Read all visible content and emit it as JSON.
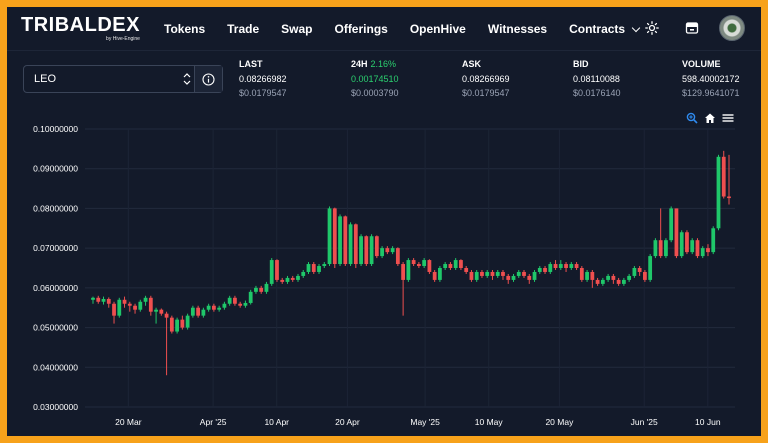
{
  "nav": {
    "brand": "TRIBALDEX",
    "brand_sub": "by Hive-Engine",
    "items": [
      "Tokens",
      "Trade",
      "Swap",
      "Offerings",
      "OpenHive",
      "Witnesses"
    ],
    "contracts": "Contracts",
    "icons": [
      "sun-icon",
      "wallet-icon",
      "avatar"
    ]
  },
  "pair": {
    "value": "LEO"
  },
  "stats": [
    {
      "label": "LAST",
      "value": "0.08266982",
      "usd": "$0.0179547"
    },
    {
      "label": "24H",
      "change": "2.16%",
      "value": "0.00174510",
      "usd": "$0.0003790"
    },
    {
      "label": "ASK",
      "value": "0.08266969",
      "usd": "$0.0179547"
    },
    {
      "label": "BID",
      "value": "0.08110088",
      "usd": "$0.0176140"
    },
    {
      "label": "VOLUME",
      "value": "598.40002172",
      "usd": "$129.9641071"
    }
  ],
  "colors": {
    "up": "#1fc76a",
    "down": "#ef4f4f",
    "accent": "#2bd06f",
    "bg": "#131a2a",
    "border": "#f7a21b"
  },
  "chart_data": {
    "type": "candlestick",
    "ylim": [
      0.03,
      0.1
    ],
    "yticks": [
      "0.03000000",
      "0.04000000",
      "0.05000000",
      "0.06000000",
      "0.07000000",
      "0.08000000",
      "0.09000000",
      "0.10000000"
    ],
    "xticks": [
      "20 Mar",
      "Apr '25",
      "10 Apr",
      "20 Apr",
      "May '25",
      "10 May",
      "20 May",
      "Jun '25",
      "10 Jun"
    ],
    "x_start": "2025-03-15",
    "candles": [
      [
        0.057,
        0.0575,
        0.056,
        0.0578
      ],
      [
        0.0575,
        0.0565,
        0.056,
        0.058
      ],
      [
        0.0565,
        0.0572,
        0.0558,
        0.0578
      ],
      [
        0.0572,
        0.056,
        0.055,
        0.0576
      ],
      [
        0.056,
        0.053,
        0.051,
        0.0565
      ],
      [
        0.053,
        0.057,
        0.0525,
        0.0575
      ],
      [
        0.057,
        0.056,
        0.055,
        0.0578
      ],
      [
        0.056,
        0.0555,
        0.054,
        0.0565
      ],
      [
        0.0555,
        0.0545,
        0.0535,
        0.056
      ],
      [
        0.0545,
        0.0565,
        0.054,
        0.057
      ],
      [
        0.0565,
        0.0575,
        0.0555,
        0.058
      ],
      [
        0.0575,
        0.054,
        0.053,
        0.058
      ],
      [
        0.054,
        0.0545,
        0.051,
        0.055
      ],
      [
        0.0545,
        0.0535,
        0.053,
        0.0548
      ],
      [
        0.0535,
        0.0525,
        0.038,
        0.054
      ],
      [
        0.0525,
        0.049,
        0.0485,
        0.053
      ],
      [
        0.049,
        0.052,
        0.0485,
        0.0525
      ],
      [
        0.052,
        0.05,
        0.0495,
        0.053
      ],
      [
        0.05,
        0.053,
        0.0495,
        0.0535
      ],
      [
        0.053,
        0.055,
        0.0525,
        0.0555
      ],
      [
        0.055,
        0.053,
        0.0525,
        0.0555
      ],
      [
        0.053,
        0.0545,
        0.0525,
        0.055
      ],
      [
        0.0545,
        0.0555,
        0.054,
        0.056
      ],
      [
        0.0555,
        0.0545,
        0.054,
        0.056
      ],
      [
        0.0545,
        0.055,
        0.054,
        0.0555
      ],
      [
        0.055,
        0.056,
        0.0545,
        0.0565
      ],
      [
        0.056,
        0.0575,
        0.0555,
        0.058
      ],
      [
        0.0575,
        0.056,
        0.0555,
        0.058
      ],
      [
        0.056,
        0.0555,
        0.055,
        0.0565
      ],
      [
        0.0555,
        0.0562,
        0.055,
        0.0568
      ],
      [
        0.0562,
        0.059,
        0.0558,
        0.0595
      ],
      [
        0.059,
        0.06,
        0.0585,
        0.0605
      ],
      [
        0.06,
        0.059,
        0.0585,
        0.0605
      ],
      [
        0.059,
        0.061,
        0.0585,
        0.0615
      ],
      [
        0.061,
        0.067,
        0.0605,
        0.0675
      ],
      [
        0.067,
        0.062,
        0.0615,
        0.0672
      ],
      [
        0.062,
        0.0615,
        0.061,
        0.0625
      ],
      [
        0.0615,
        0.0625,
        0.061,
        0.063
      ],
      [
        0.0625,
        0.062,
        0.0615,
        0.063
      ],
      [
        0.062,
        0.063,
        0.0615,
        0.0635
      ],
      [
        0.063,
        0.064,
        0.0625,
        0.0645
      ],
      [
        0.064,
        0.066,
        0.0635,
        0.0665
      ],
      [
        0.066,
        0.064,
        0.0635,
        0.0665
      ],
      [
        0.064,
        0.0655,
        0.0635,
        0.066
      ],
      [
        0.0655,
        0.066,
        0.065,
        0.0665
      ],
      [
        0.066,
        0.08,
        0.0655,
        0.0805
      ],
      [
        0.08,
        0.066,
        0.065,
        0.0802
      ],
      [
        0.066,
        0.078,
        0.0655,
        0.0785
      ],
      [
        0.078,
        0.066,
        0.0655,
        0.0782
      ],
      [
        0.066,
        0.076,
        0.0655,
        0.0765
      ],
      [
        0.076,
        0.066,
        0.065,
        0.0762
      ],
      [
        0.066,
        0.073,
        0.0655,
        0.0735
      ],
      [
        0.073,
        0.066,
        0.0655,
        0.0732
      ],
      [
        0.066,
        0.073,
        0.0655,
        0.0735
      ],
      [
        0.073,
        0.068,
        0.0675,
        0.0732
      ],
      [
        0.068,
        0.07,
        0.0675,
        0.0705
      ],
      [
        0.07,
        0.069,
        0.0685,
        0.0705
      ],
      [
        0.069,
        0.07,
        0.0685,
        0.0705
      ],
      [
        0.07,
        0.066,
        0.0655,
        0.0702
      ],
      [
        0.066,
        0.062,
        0.053,
        0.0665
      ],
      [
        0.062,
        0.067,
        0.0615,
        0.0675
      ],
      [
        0.067,
        0.066,
        0.0655,
        0.0675
      ],
      [
        0.066,
        0.0655,
        0.065,
        0.0665
      ],
      [
        0.0655,
        0.067,
        0.065,
        0.0675
      ],
      [
        0.067,
        0.064,
        0.0635,
        0.0672
      ],
      [
        0.064,
        0.062,
        0.0615,
        0.0645
      ],
      [
        0.062,
        0.065,
        0.0615,
        0.0655
      ],
      [
        0.065,
        0.066,
        0.0645,
        0.0665
      ],
      [
        0.066,
        0.065,
        0.0645,
        0.0665
      ],
      [
        0.065,
        0.067,
        0.0645,
        0.0675
      ],
      [
        0.067,
        0.065,
        0.0645,
        0.0672
      ],
      [
        0.065,
        0.064,
        0.0635,
        0.0655
      ],
      [
        0.064,
        0.062,
        0.0615,
        0.0645
      ],
      [
        0.062,
        0.064,
        0.0615,
        0.0645
      ],
      [
        0.064,
        0.063,
        0.0625,
        0.0645
      ],
      [
        0.063,
        0.064,
        0.0625,
        0.0645
      ],
      [
        0.064,
        0.063,
        0.062,
        0.0645
      ],
      [
        0.063,
        0.064,
        0.0625,
        0.0645
      ],
      [
        0.064,
        0.063,
        0.062,
        0.0645
      ],
      [
        0.063,
        0.062,
        0.061,
        0.0635
      ],
      [
        0.062,
        0.063,
        0.0615,
        0.0635
      ],
      [
        0.063,
        0.064,
        0.0625,
        0.0645
      ],
      [
        0.064,
        0.063,
        0.0625,
        0.0645
      ],
      [
        0.063,
        0.062,
        0.061,
        0.0635
      ],
      [
        0.062,
        0.064,
        0.0615,
        0.0645
      ],
      [
        0.064,
        0.065,
        0.0635,
        0.0655
      ],
      [
        0.065,
        0.064,
        0.0635,
        0.0655
      ],
      [
        0.064,
        0.066,
        0.0635,
        0.0665
      ],
      [
        0.066,
        0.065,
        0.0645,
        0.067
      ],
      [
        0.065,
        0.066,
        0.0645,
        0.067
      ],
      [
        0.066,
        0.065,
        0.064,
        0.0665
      ],
      [
        0.065,
        0.066,
        0.0645,
        0.0665
      ],
      [
        0.066,
        0.065,
        0.0645,
        0.0665
      ],
      [
        0.065,
        0.062,
        0.0615,
        0.0655
      ],
      [
        0.062,
        0.064,
        0.0615,
        0.0645
      ],
      [
        0.064,
        0.062,
        0.06,
        0.0645
      ],
      [
        0.062,
        0.061,
        0.0605,
        0.0625
      ],
      [
        0.061,
        0.062,
        0.0605,
        0.0625
      ],
      [
        0.062,
        0.063,
        0.0615,
        0.0635
      ],
      [
        0.063,
        0.062,
        0.061,
        0.0635
      ],
      [
        0.062,
        0.061,
        0.0605,
        0.0625
      ],
      [
        0.061,
        0.062,
        0.0605,
        0.0625
      ],
      [
        0.062,
        0.063,
        0.0615,
        0.0635
      ],
      [
        0.063,
        0.065,
        0.0625,
        0.0655
      ],
      [
        0.065,
        0.064,
        0.063,
        0.0655
      ],
      [
        0.064,
        0.062,
        0.0615,
        0.0645
      ],
      [
        0.062,
        0.068,
        0.0615,
        0.0685
      ],
      [
        0.068,
        0.072,
        0.0675,
        0.0725
      ],
      [
        0.072,
        0.068,
        0.0675,
        0.08
      ],
      [
        0.068,
        0.072,
        0.0675,
        0.0725
      ],
      [
        0.072,
        0.08,
        0.0715,
        0.0805
      ],
      [
        0.08,
        0.068,
        0.0675,
        0.08
      ],
      [
        0.068,
        0.074,
        0.0675,
        0.0745
      ],
      [
        0.074,
        0.069,
        0.0685,
        0.0745
      ],
      [
        0.069,
        0.072,
        0.0685,
        0.0725
      ],
      [
        0.072,
        0.068,
        0.0675,
        0.0725
      ],
      [
        0.068,
        0.07,
        0.0675,
        0.0705
      ],
      [
        0.07,
        0.069,
        0.068,
        0.071
      ],
      [
        0.069,
        0.075,
        0.0685,
        0.0755
      ],
      [
        0.075,
        0.093,
        0.0745,
        0.0935
      ],
      [
        0.093,
        0.083,
        0.0825,
        0.0945
      ],
      [
        0.083,
        0.0826,
        0.081,
        0.0935
      ]
    ]
  }
}
